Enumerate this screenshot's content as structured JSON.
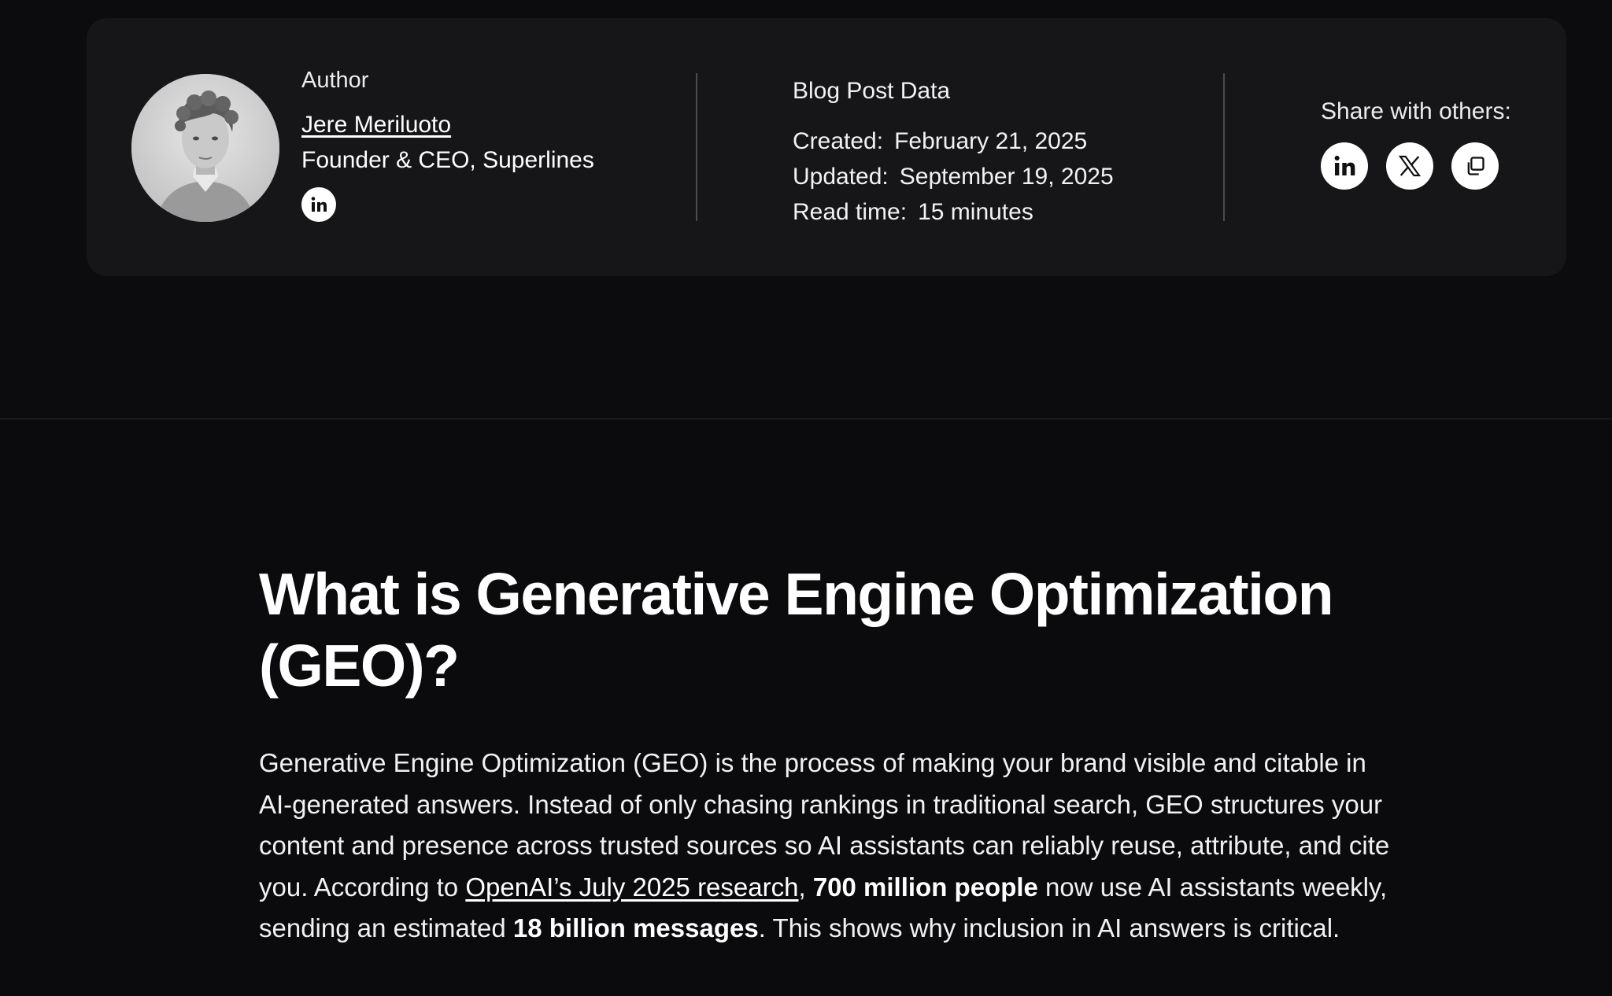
{
  "author": {
    "label": "Author",
    "name": "Jere Meriluoto",
    "role": "Founder & CEO, Superlines"
  },
  "meta": {
    "label": "Blog Post Data",
    "created_label": "Created:",
    "created": "February 21, 2025",
    "updated_label": "Updated:",
    "updated": "September 19, 2025",
    "read_label": "Read time:",
    "read": "15 minutes"
  },
  "share": {
    "label": "Share with others:",
    "icons": [
      "linkedin-icon",
      "x-icon",
      "copy-icon"
    ]
  },
  "article": {
    "title": "What is Generative Engine Optimization (GEO)?",
    "p1_part1": "Generative Engine Optimization (GEO) is the process of making your brand visible and citable in AI-generated answers. Instead of only chasing rankings in traditional search, GEO structures your content and presence across trusted sources so AI assistants can reliably reuse, attribute, and cite you. According to ",
    "p1_link": "OpenAI’s July 2025 research",
    "p1_part2": ", ",
    "p1_bold1": "700 million people",
    "p1_part3": " now use AI assistants weekly, sending an estimated ",
    "p1_bold2": "18 billion messages",
    "p1_part4": ". This shows why inclusion in AI answers is critical."
  },
  "colors": {
    "background": "#0b0b0d",
    "card": "#161619",
    "text": "#ffffff"
  }
}
